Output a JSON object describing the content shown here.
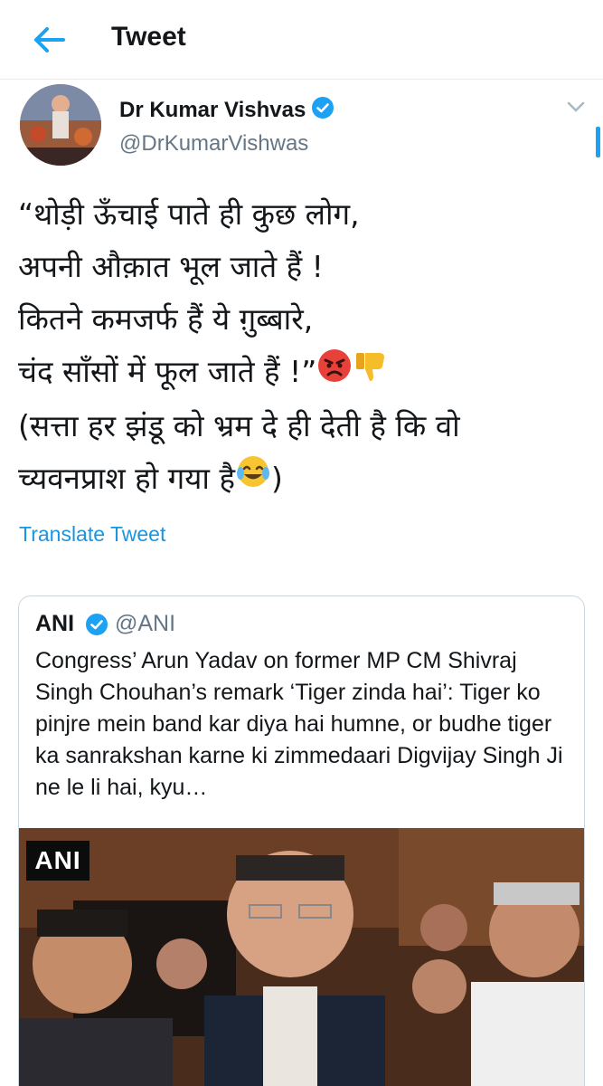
{
  "header": {
    "title": "Tweet"
  },
  "tweet": {
    "author_name": "Dr Kumar Vishvas",
    "author_handle": "@DrKumarVishwas",
    "lines": [
      "“थोड़ी ऊँचाई पाते ही कुछ लोग,",
      "अपनी औक़ात भूल जाते हैं !",
      "कितने कमजर्फ हैं ये ग़ुब्बारे,",
      "चंद साँसों में फूल जाते हैं !”",
      "(सत्ता हर झंडू को भ्रम दे ही देती है कि वो",
      "च्यवनप्राश हो गया है",
      ")"
    ],
    "translate_label": "Translate Tweet"
  },
  "quoted": {
    "name": "ANI",
    "handle": "@ANI",
    "text": "Congress’ Arun Yadav on former MP CM Shivraj Singh Chouhan’s remark ‘Tiger zinda hai’: Tiger ko pinjre mein band kar diya hai humne, or budhe tiger ka sanrakshan karne ki zimmedaari Digvijay Singh Ji ne le li hai, kyu…",
    "image_watermark": "ANI"
  },
  "colors": {
    "accent": "#1da1f2",
    "link": "#1b95e0",
    "secondary_text": "#657786",
    "border": "#ccd6dd"
  },
  "icons": {
    "back": "arrow-left-icon",
    "verified": "verified-badge-icon",
    "caret": "chevron-down-icon",
    "angry": "angry-face-emoji",
    "thumbs_down": "thumbs-down-emoji",
    "laugh": "tears-of-joy-emoji"
  }
}
